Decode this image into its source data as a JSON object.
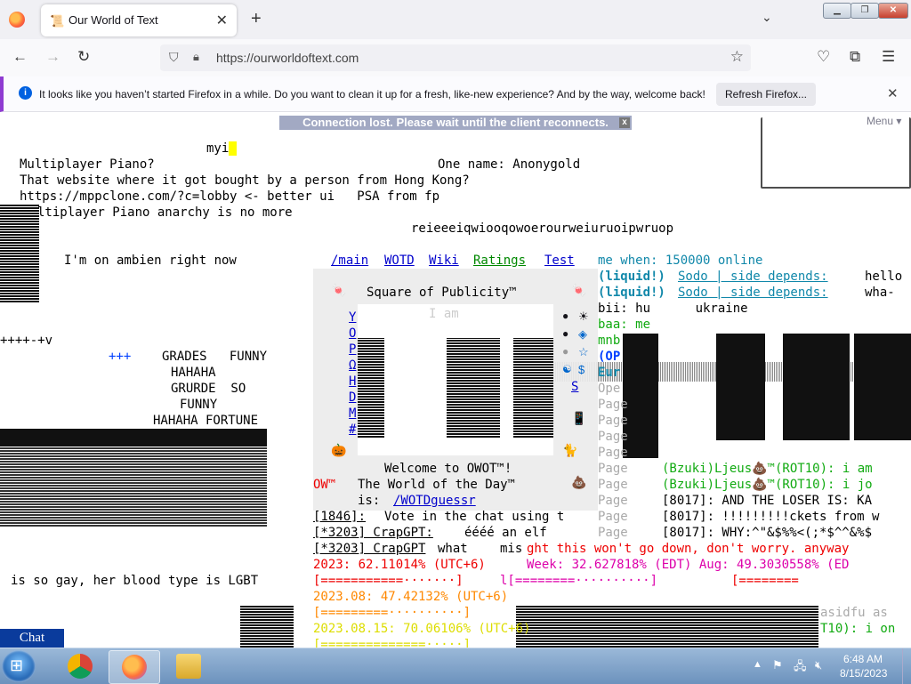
{
  "browser": {
    "tab_title": "Our World of Text",
    "url": "https://ourworldoftext.com",
    "notification": "It looks like you haven’t started Firefox in a while. Do you want to clean it up for a fresh, like-new experience? And by the way, welcome back!",
    "refresh_label": "Refresh Firefox..."
  },
  "page": {
    "connection_banner": "Connection lost. Please wait until the client reconnects.",
    "banner_close": "x",
    "menu_label": "Menu ▾",
    "lines": {
      "myi": "myi",
      "l1": "Multiplayer Piano?",
      "l1b": "One name: Anonygold",
      "l2": "That website where it got bought by a person from Hong Kong?",
      "l3": "https://mppclone.com/?c=lobby <- better ui   PSA from fp",
      "l4": "ltiplayer Piano anarchy is no more",
      "l5": "reieeeiqwiooqowoerourweiuruoipwruop",
      "l6": "I'm on ambien right now",
      "l7": "++++-+v",
      "l8a": "+++",
      "l8b": "GRADES   FUNNY",
      "l9": "HAHAHA",
      "l10": "GRURDE  SO",
      "l11": "FUNNY",
      "l12": "HAHAHA FORTUNE",
      "l13": "is so gay, her blood type is LGBT"
    },
    "nav": {
      "main": "/main",
      "wotd": "WOTD",
      "wiki": "Wiki",
      "ratings": "Ratings",
      "test": "Test"
    },
    "panel": {
      "title": "Square of Publicity™",
      "big_text": "I am",
      "welcome": "Welcome to OWOT™!",
      "wotd_line": "The World of the Day™",
      "is": "is:",
      "wotd_link": "/WOTDguessr",
      "ow": "OW™",
      "left_letters": [
        "Y",
        "O",
        "P",
        "Ω",
        "H",
        "D",
        "M",
        "#"
      ],
      "right_letters": [
        "S"
      ]
    },
    "chat": {
      "c1a": "me when: 150000 online",
      "c2a": "(liquid!)",
      "c2b": "Sodo | side depends:",
      "c2c": "hello",
      "c3b": "Sodo | side depends:",
      "c3c": "wha-",
      "c4": "bii: hu      ukraine",
      "c5": "baa: me",
      "c6": "mnb",
      "c7": "(OP",
      "c8": "Eur",
      "c9": "Ope",
      "page_word": "Page",
      "c10": "(Bzuki)Ljeus💩™(ROT10): i am",
      "c11": "(Bzuki)Ljeus💩™(ROT10): i jo",
      "c12": "[8017]: AND THE LOSER IS: KA",
      "c13": "[8017]: !!!!!!!!!ckets from w",
      "c14": "[8017]: WHY:^\"&$%%<(;*$^^&%$",
      "r1a": "[1846]:",
      "r1b": "Vote in the chat using t",
      "r2a": "[*3203] CrapGPT:",
      "r2b": "éééé an elf",
      "r3a": "[*3203] CrapGPT",
      "r3b": "what",
      "r3c": "mis",
      "r3d": "ght this won't go down, don't worry. anyway",
      "p1": "2023: 62.11014% (UTC+6)",
      "p1b": "Week: 32.627818% (EDT) Aug: 49.3030558% (ED",
      "bar1": "[===========·······]",
      "bar2": "l[========··········]",
      "bar3": "[========",
      "p2": "2023.08: 47.42132% (UTC+6)",
      "bar4": "[=========··········]",
      "p3": "2023.08.15: 70.06106% (UTC+6)",
      "bar5": "[==============·····]",
      "asid": "asidfu as",
      "rot": "T10): i on"
    },
    "chat_button": "Chat"
  },
  "taskbar": {
    "time": "6:48 AM",
    "date": "8/15/2023"
  }
}
